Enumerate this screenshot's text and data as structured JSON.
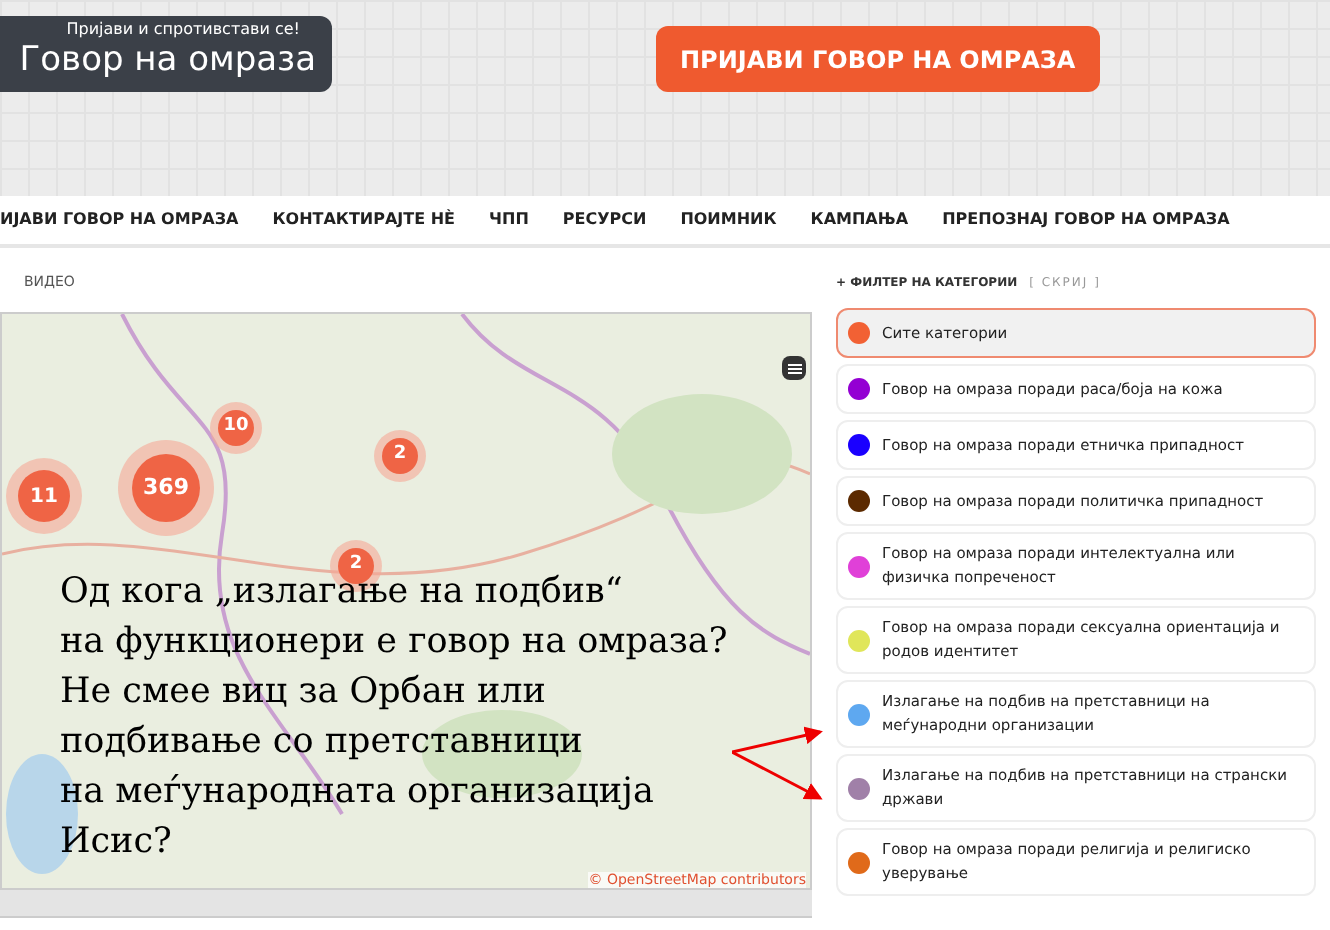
{
  "header": {
    "logo": {
      "tagline": "Пријави и спротивстави се!",
      "title": "Говор на омраза"
    },
    "report_button": "ПРИЈАВИ ГОВОР НА ОМРАЗА"
  },
  "nav": [
    {
      "label": "ИЈАВИ ГОВОР НА ОМРАЗА"
    },
    {
      "label": "КОНТАКТИРАЈТЕ НÈ"
    },
    {
      "label": "ЧПП"
    },
    {
      "label": "РЕСУРСИ"
    },
    {
      "label": "ПОИМНИК"
    },
    {
      "label": "КАМПАЊА"
    },
    {
      "label": "ПРЕПОЗНАЈ ГОВОР НА ОМРАЗА"
    }
  ],
  "section_label": "ВИДЕО",
  "map": {
    "markers": [
      {
        "count": "11",
        "kind": "medium"
      },
      {
        "count": "369",
        "kind": "large"
      },
      {
        "count": "10",
        "kind": "small"
      },
      {
        "count": "2",
        "kind": "small"
      },
      {
        "count": "2",
        "kind": "small"
      }
    ],
    "attribution": "© OpenStreetMap contributors"
  },
  "annotation": {
    "lines": [
      "Од кога „излагање на подбив“",
      "на функционери е говор на омраза?",
      "Не смее виц за Орбан или",
      "подбивање со претставници",
      "на меѓународната организација",
      "Исис?"
    ]
  },
  "filter": {
    "title": "+ ФИЛТЕР НА КАТЕГОРИИ",
    "toggle": "[ СКРИЈ ]",
    "categories": [
      {
        "label": "Сите категории",
        "color": "#f26134",
        "selected": true
      },
      {
        "label": "Говор на омраза поради раса/боја на кожа",
        "color": "#9400d3",
        "selected": false
      },
      {
        "label": "Говор на омраза поради етничка припадност",
        "color": "#1a00ff",
        "selected": false
      },
      {
        "label": "Говор на омраза поради политичка припадност",
        "color": "#5c2a00",
        "selected": false
      },
      {
        "label": "Говор на омраза поради интелектуална или физичка попреченост",
        "color": "#e040d8",
        "selected": false
      },
      {
        "label": "Говор на омраза поради сексуална ориентација и родов идентитет",
        "color": "#e0e65a",
        "selected": false
      },
      {
        "label": "Излагање на подбив на претставници на меѓународни организации",
        "color": "#5ea8f0",
        "selected": false
      },
      {
        "label": "Излагање на подбив на претставници на странски држави",
        "color": "#a080a8",
        "selected": false
      },
      {
        "label": "Говор на омраза поради религија и религиско уверување",
        "color": "#e06a1a",
        "selected": false
      }
    ]
  }
}
